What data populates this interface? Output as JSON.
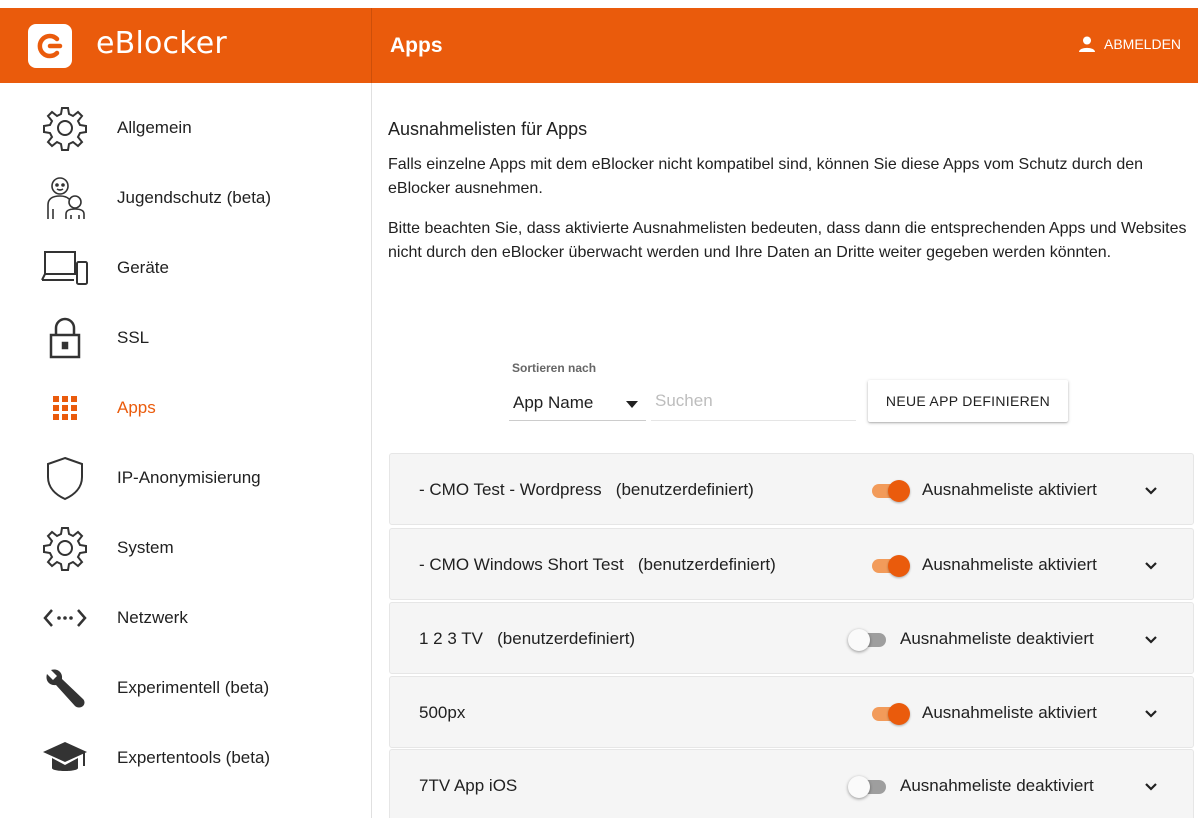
{
  "header": {
    "brand_name": "eBlocker",
    "page_title": "Apps",
    "logout_label": "ABMELDEN",
    "accent_color": "#ea5b0c"
  },
  "sidebar": {
    "items": [
      {
        "label": "Allgemein",
        "icon": "gear-icon",
        "active": false
      },
      {
        "label": "Jugendschutz (beta)",
        "icon": "family-icon",
        "active": false
      },
      {
        "label": "Geräte",
        "icon": "devices-icon",
        "active": false
      },
      {
        "label": "SSL",
        "icon": "lock-icon",
        "active": false
      },
      {
        "label": "Apps",
        "icon": "apps-grid-icon",
        "active": true
      },
      {
        "label": "IP-Anonymisierung",
        "icon": "shield-icon",
        "active": false
      },
      {
        "label": "System",
        "icon": "gear-icon",
        "active": false
      },
      {
        "label": "Netzwerk",
        "icon": "network-icon",
        "active": false
      },
      {
        "label": "Experimentell (beta)",
        "icon": "wrench-icon",
        "active": false
      },
      {
        "label": "Expertentools (beta)",
        "icon": "graduation-cap-icon",
        "active": false
      }
    ]
  },
  "main": {
    "heading": "Ausnahmelisten für Apps",
    "paragraph1": "Falls einzelne Apps mit dem eBlocker nicht kompatibel sind, können Sie diese Apps vom Schutz durch den eBlocker ausnehmen.",
    "paragraph2": "Bitte beachten Sie, dass aktivierte Ausnahmelisten bedeuten, dass dann die entsprechenden Apps und Websites nicht durch den eBlocker überwacht werden und Ihre Daten an Dritte weiter gegeben werden könnten.",
    "sort_label": "Sortieren nach",
    "sort_value": "App Name",
    "search_placeholder": "Suchen",
    "new_app_button": "NEUE APP DEFINIEREN",
    "apps": [
      {
        "name": "- CMO Test - Wordpress   (benutzerdefiniert)",
        "enabled": true,
        "status": "Ausnahmeliste aktiviert"
      },
      {
        "name": "- CMO Windows Short Test   (benutzerdefiniert)",
        "enabled": true,
        "status": "Ausnahmeliste aktiviert"
      },
      {
        "name": "1 2 3 TV   (benutzerdefiniert)",
        "enabled": false,
        "status": "Ausnahmeliste deaktiviert"
      },
      {
        "name": "500px",
        "enabled": true,
        "status": "Ausnahmeliste aktiviert"
      },
      {
        "name": "7TV App iOS",
        "enabled": false,
        "status": "Ausnahmeliste deaktiviert"
      }
    ]
  }
}
